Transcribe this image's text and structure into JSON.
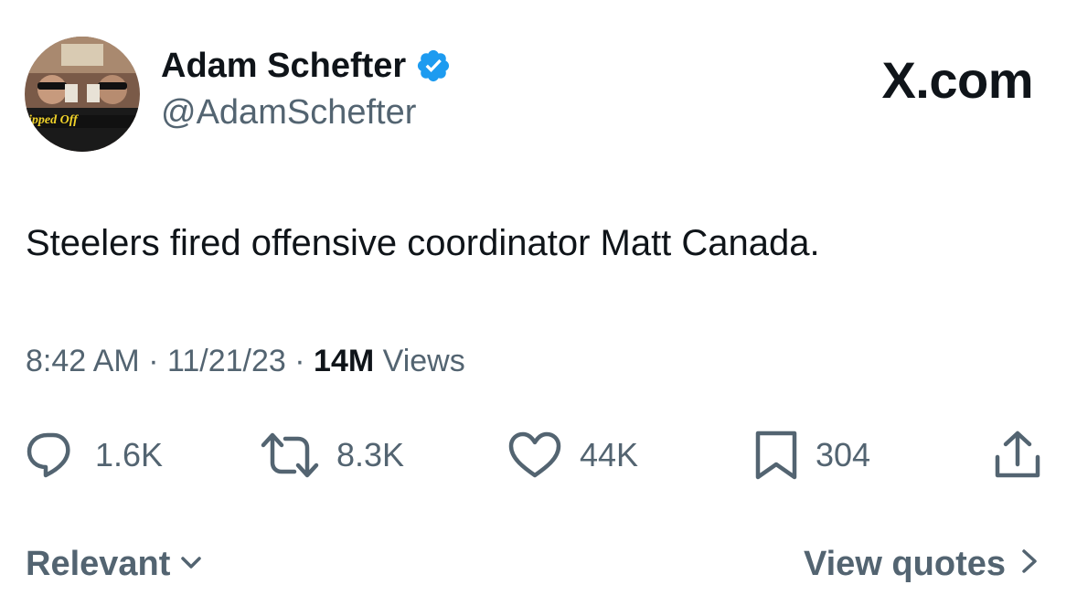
{
  "author": {
    "display_name": "Adam Schefter",
    "handle": "@AdamSchefter",
    "verified": true,
    "avatar_caption": "ipped Off"
  },
  "brand": "X.com",
  "tweet": {
    "text": "Steelers fired offensive coordinator Matt Canada."
  },
  "meta": {
    "time": "8:42 AM",
    "date": "11/21/23",
    "views_count": "14M",
    "views_label": "Views",
    "separator": "·"
  },
  "actions": {
    "replies": "1.6K",
    "reposts": "8.3K",
    "likes": "44K",
    "bookmarks": "304"
  },
  "footer": {
    "sort_label": "Relevant",
    "view_quotes_label": "View quotes"
  },
  "colors": {
    "text": "#0f1419",
    "secondary": "#536471",
    "verified": "#1d9bf0"
  },
  "icons": [
    "verified-badge-icon",
    "reply-icon",
    "repost-icon",
    "like-icon",
    "bookmark-icon",
    "share-icon",
    "chevron-down-icon",
    "chevron-right-icon"
  ]
}
